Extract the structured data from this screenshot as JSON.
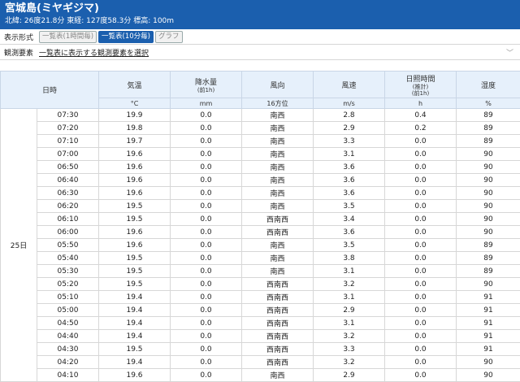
{
  "station": {
    "title": "宮城島(ミヤギジマ)",
    "meta": "北緯: 26度21.8分 東経: 127度58.3分 標高: 100m"
  },
  "display": {
    "label": "表示形式",
    "buttons": [
      "一覧表(1時間毎)",
      "一覧表(10分毎)",
      "グラフ"
    ]
  },
  "elements": {
    "label": "観測要素",
    "value": "一覧表に表示する観測要素を選択"
  },
  "table": {
    "headers": {
      "datetime": "日時",
      "temp": "気温",
      "precip": "降水量",
      "precip_sub": "(前1h)",
      "wind_dir": "風向",
      "wind_speed": "風速",
      "sunshine": "日照時間",
      "sunshine_sub1": "(推計)",
      "sunshine_sub2": "(前1h)",
      "humidity": "湿度"
    },
    "units": [
      "°C",
      "mm",
      "16方位",
      "m/s",
      "h",
      "%"
    ],
    "day": "25日",
    "rows": [
      [
        "07:30",
        "19.9",
        "0.0",
        "南西",
        "2.8",
        "0.4",
        "89"
      ],
      [
        "07:20",
        "19.8",
        "0.0",
        "南西",
        "2.9",
        "0.2",
        "89"
      ],
      [
        "07:10",
        "19.7",
        "0.0",
        "南西",
        "3.3",
        "0.0",
        "89"
      ],
      [
        "07:00",
        "19.6",
        "0.0",
        "南西",
        "3.1",
        "0.0",
        "90"
      ],
      [
        "06:50",
        "19.6",
        "0.0",
        "南西",
        "3.6",
        "0.0",
        "90"
      ],
      [
        "06:40",
        "19.6",
        "0.0",
        "南西",
        "3.6",
        "0.0",
        "90"
      ],
      [
        "06:30",
        "19.6",
        "0.0",
        "南西",
        "3.6",
        "0.0",
        "90"
      ],
      [
        "06:20",
        "19.5",
        "0.0",
        "南西",
        "3.5",
        "0.0",
        "90"
      ],
      [
        "06:10",
        "19.5",
        "0.0",
        "西南西",
        "3.4",
        "0.0",
        "90"
      ],
      [
        "06:00",
        "19.6",
        "0.0",
        "西南西",
        "3.6",
        "0.0",
        "90"
      ],
      [
        "05:50",
        "19.6",
        "0.0",
        "南西",
        "3.5",
        "0.0",
        "89"
      ],
      [
        "05:40",
        "19.5",
        "0.0",
        "南西",
        "3.8",
        "0.0",
        "89"
      ],
      [
        "05:30",
        "19.5",
        "0.0",
        "南西",
        "3.1",
        "0.0",
        "89"
      ],
      [
        "05:20",
        "19.5",
        "0.0",
        "西南西",
        "3.2",
        "0.0",
        "90"
      ],
      [
        "05:10",
        "19.4",
        "0.0",
        "西南西",
        "3.1",
        "0.0",
        "91"
      ],
      [
        "05:00",
        "19.4",
        "0.0",
        "西南西",
        "2.9",
        "0.0",
        "91"
      ],
      [
        "04:50",
        "19.4",
        "0.0",
        "西南西",
        "3.1",
        "0.0",
        "91"
      ],
      [
        "04:40",
        "19.4",
        "0.0",
        "西南西",
        "3.2",
        "0.0",
        "91"
      ],
      [
        "04:30",
        "19.5",
        "0.0",
        "西南西",
        "3.3",
        "0.0",
        "91"
      ],
      [
        "04:20",
        "19.4",
        "0.0",
        "西南西",
        "3.2",
        "0.0",
        "90"
      ],
      [
        "04:10",
        "19.6",
        "0.0",
        "南西",
        "2.9",
        "0.0",
        "90"
      ]
    ]
  }
}
